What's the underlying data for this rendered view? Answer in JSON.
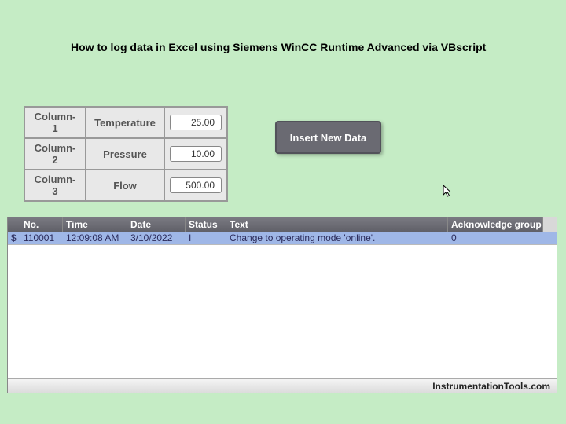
{
  "title": "How to log data in Excel using Siemens WinCC Runtime Advanced via VBscript",
  "rows": [
    {
      "col": "Column-1",
      "label": "Temperature",
      "value": "25.00"
    },
    {
      "col": "Column-2",
      "label": "Pressure",
      "value": "10.00"
    },
    {
      "col": "Column-3",
      "label": "Flow",
      "value": "500.00"
    }
  ],
  "button": {
    "label": "Insert New Data"
  },
  "alarm": {
    "headers": {
      "no": "No.",
      "time": "Time",
      "date": "Date",
      "status": "Status",
      "text": "Text",
      "ack": "Acknowledge group"
    },
    "row": {
      "flag": "$",
      "no": "110001",
      "time": "12:09:08 AM",
      "date": "3/10/2022",
      "status": "I",
      "text": "Change to operating mode 'online'.",
      "ack": "0"
    }
  },
  "footer": "InstrumentationTools.com"
}
